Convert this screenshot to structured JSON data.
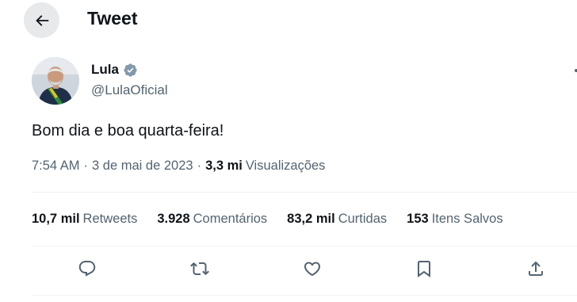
{
  "header": {
    "title": "Tweet",
    "back_icon": "arrow-left-icon"
  },
  "author": {
    "name": "Lula",
    "handle": "@LulaOficial",
    "verified_icon": "verified-badge-icon",
    "verified_color": "#829aab"
  },
  "tweet": {
    "text": "Bom dia e boa quarta-feira!",
    "time": "7:54 AM",
    "date": "3 de mai de 2023",
    "views_count": "3,3 mi",
    "views_label": "Visualizações",
    "separator": "·"
  },
  "stats": [
    {
      "count": "10,7 mil",
      "label": "Retweets"
    },
    {
      "count": "3.928",
      "label": "Comentários"
    },
    {
      "count": "83,2 mil",
      "label": "Curtidas"
    },
    {
      "count": "153",
      "label": "Itens Salvos"
    }
  ],
  "actions": [
    {
      "name": "reply",
      "icon": "reply-icon"
    },
    {
      "name": "retweet",
      "icon": "retweet-icon"
    },
    {
      "name": "like",
      "icon": "heart-icon"
    },
    {
      "name": "bookmark",
      "icon": "bookmark-icon"
    },
    {
      "name": "share",
      "icon": "share-icon"
    }
  ],
  "colors": {
    "text": "#0f1419",
    "secondary": "#536471",
    "divider": "#eff3f4",
    "back_button_bg": "#e7e9ea"
  }
}
